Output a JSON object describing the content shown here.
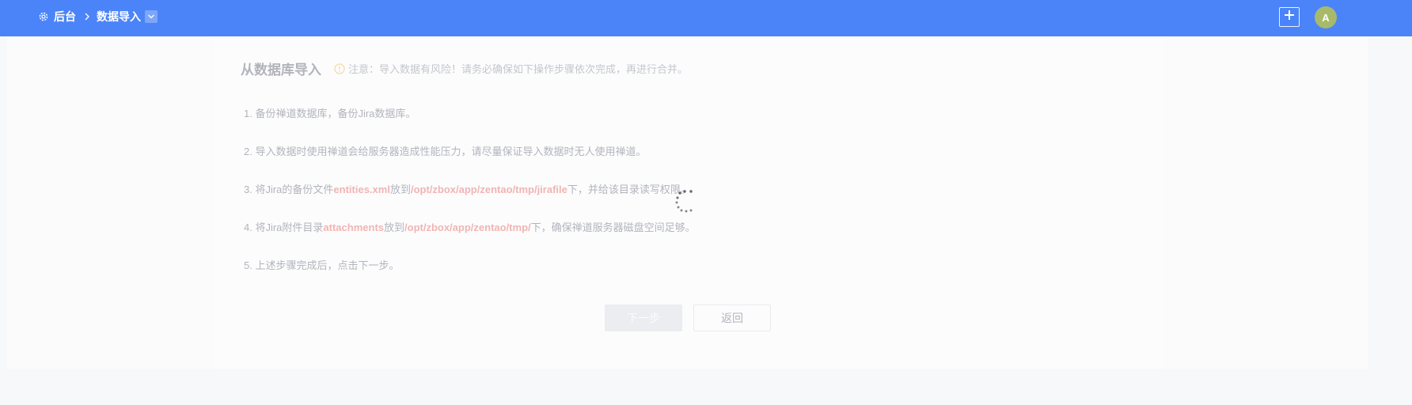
{
  "header": {
    "breadcrumb_root": "后台",
    "breadcrumb_current": "数据导入",
    "icons": [
      "gear-icon",
      "chevron-right-icon",
      "chevron-down-icon",
      "plus-icon"
    ],
    "avatar_initial": "A",
    "colors": {
      "bar": "#4b84f8",
      "avatar": "#a8ba6a"
    }
  },
  "main": {
    "title": "从数据库导入",
    "warning": "注意：导入数据有风险！请务必确保如下操作步骤依次完成，再进行合并。",
    "steps": [
      {
        "num": "1.",
        "text": "备份禅道数据库，备份Jira数据库。"
      },
      {
        "num": "2.",
        "text": "导入数据时使用禅道会给服务器造成性能压力，请尽量保证导入数据时无人使用禅道。"
      },
      {
        "num": "3.",
        "pre": "将Jira的备份文件",
        "file": "entities.xml",
        "mid": "放到",
        "path": "/opt/zbox/app/zentao/tmp/jirafile",
        "post": "下，并给该目录读写权限。"
      },
      {
        "num": "4.",
        "pre": "将Jira附件目录",
        "file": "attachments",
        "mid": "放到",
        "path": "/opt/zbox/app/zentao/tmp/",
        "post": "下，确保禅道服务器磁盘空间足够。"
      },
      {
        "num": "5.",
        "text": "上述步骤完成后，点击下一步。"
      }
    ],
    "next_label": "下一步",
    "back_label": "返回",
    "colors": {
      "highlight": "#e0443c",
      "warning_icon": "#f5a623"
    }
  },
  "loading_icon": "spinner-icon"
}
